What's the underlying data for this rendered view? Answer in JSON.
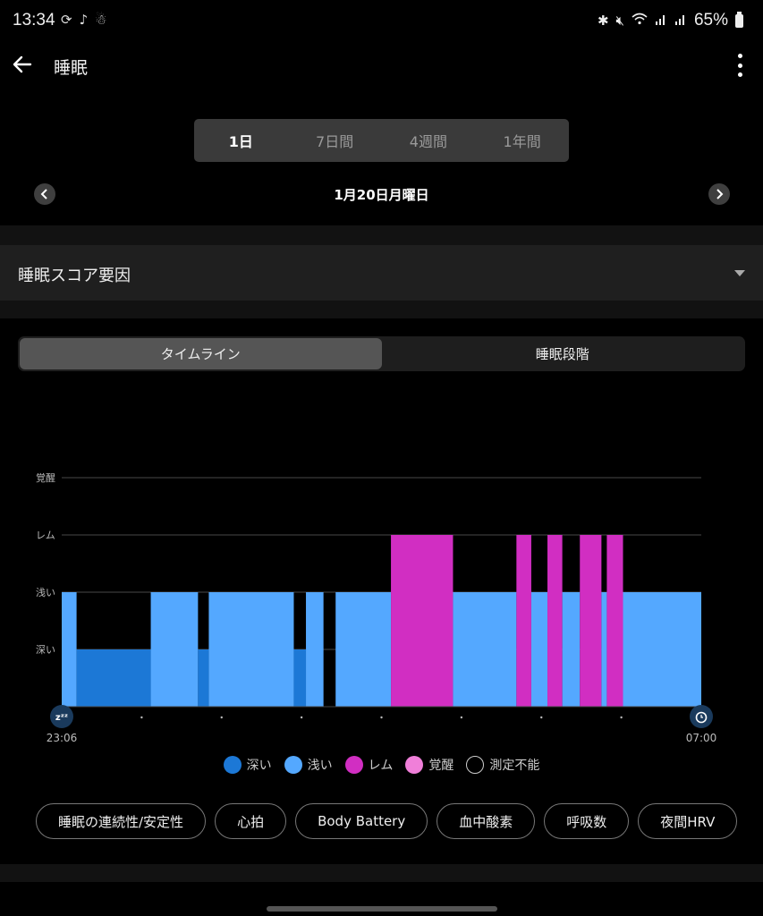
{
  "status_bar": {
    "time": "13:34",
    "left_icons": [
      "sync-icon",
      "notification-icon",
      "app-icon"
    ],
    "right_icons": [
      "bluetooth-icon",
      "mute-icon",
      "wifi-icon",
      "signal-icon",
      "signal-icon"
    ],
    "battery": "65%"
  },
  "app_bar": {
    "title": "睡眠"
  },
  "period_tabs": [
    {
      "label": "1日",
      "active": true
    },
    {
      "label": "7日間",
      "active": false
    },
    {
      "label": "4週間",
      "active": false
    },
    {
      "label": "1年間",
      "active": false
    }
  ],
  "date_nav": {
    "date": "1月20日月曜日"
  },
  "score_factors": {
    "label": "睡眠スコア要因"
  },
  "view_toggle": [
    {
      "label": "タイムライン",
      "active": true
    },
    {
      "label": "睡眠段階",
      "active": false
    }
  ],
  "colors": {
    "deep": "#1c78d6",
    "light": "#54a8ff",
    "rem": "#d12ec2",
    "awake": "#f07fd9",
    "unmeasurable": "#000000"
  },
  "chart_data": {
    "type": "bar",
    "title": "",
    "xlabel": "",
    "ylabel": "",
    "start_label": "23:06",
    "end_label": "07:00",
    "duration_minutes": 474,
    "levels": [
      "深い",
      "浅い",
      "レム",
      "覚醒"
    ],
    "grid": true,
    "legend_position": "bottom",
    "legend": [
      {
        "key": "deep",
        "label": "深い"
      },
      {
        "key": "light",
        "label": "浅い"
      },
      {
        "key": "rem",
        "label": "レム"
      },
      {
        "key": "awake",
        "label": "覚醒"
      },
      {
        "key": "unmeasurable",
        "label": "測定不能"
      }
    ],
    "segments": [
      {
        "stage": "light",
        "start": 0,
        "end": 11
      },
      {
        "stage": "deep",
        "start": 11,
        "end": 66
      },
      {
        "stage": "light",
        "start": 66,
        "end": 101
      },
      {
        "stage": "deep",
        "start": 101,
        "end": 109
      },
      {
        "stage": "light",
        "start": 109,
        "end": 172
      },
      {
        "stage": "deep",
        "start": 172,
        "end": 181
      },
      {
        "stage": "light",
        "start": 181,
        "end": 194
      },
      {
        "stage": "unmeasurable",
        "start": 194,
        "end": 203
      },
      {
        "stage": "light",
        "start": 203,
        "end": 244
      },
      {
        "stage": "rem",
        "start": 244,
        "end": 290
      },
      {
        "stage": "light",
        "start": 290,
        "end": 337
      },
      {
        "stage": "rem",
        "start": 337,
        "end": 348
      },
      {
        "stage": "light",
        "start": 348,
        "end": 360
      },
      {
        "stage": "rem",
        "start": 360,
        "end": 371
      },
      {
        "stage": "light",
        "start": 371,
        "end": 384
      },
      {
        "stage": "rem",
        "start": 384,
        "end": 400
      },
      {
        "stage": "light",
        "start": 400,
        "end": 404
      },
      {
        "stage": "rem",
        "start": 404,
        "end": 416
      },
      {
        "stage": "light",
        "start": 416,
        "end": 474
      }
    ],
    "tick_count": 7
  },
  "metric_chips": [
    "睡眠の連続性/安定性",
    "心拍",
    "Body Battery",
    "血中酸素",
    "呼吸数",
    "夜間HRV"
  ]
}
